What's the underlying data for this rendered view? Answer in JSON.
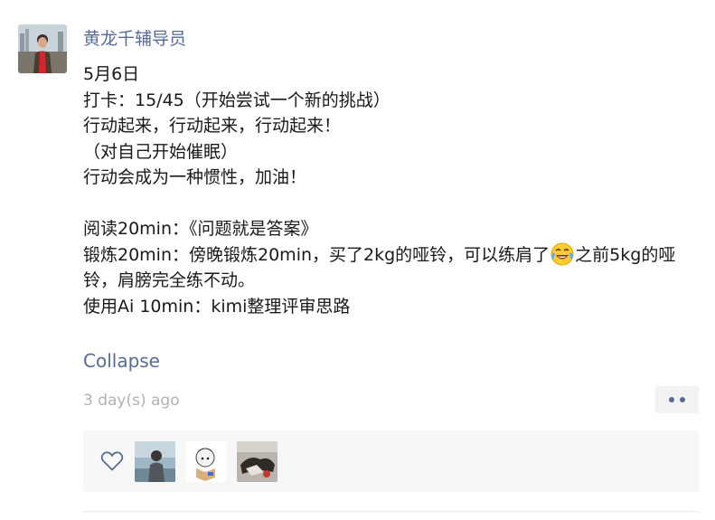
{
  "post": {
    "author": "黄龙千辅导员",
    "content_lines": [
      "5月6日",
      "打卡：15/45（开始尝试一个新的挑战）",
      "行动起来，行动起来，行动起来！",
      "（对自己开始催眠）",
      "行动会成为一种惯性，加油！",
      "",
      "阅读20min：《问题就是答案》"
    ],
    "exercise_before_emoji": "锻炼20min：傍晚锻炼20min，买了2kg的哑铃，可以练肩了",
    "exercise_after_emoji": "之前5kg的哑铃，肩膀完全练不动。",
    "emoji_name": "tears-of-joy-emoji",
    "ai_line": "使用Ai 10min：kimi整理评审思路",
    "collapse_label": "Collapse",
    "timestamp": "3 day(s) ago",
    "more_icon": "more-dots-icon",
    "like_icon": "heart-outline-icon",
    "likers": [
      "liker-avatar-1",
      "liker-avatar-2",
      "liker-avatar-3"
    ]
  },
  "colors": {
    "link": "#576b95",
    "text": "#191919",
    "meta": "#b2b2b2",
    "likes_bg": "#f7f7f7",
    "more_bg": "#f2f2f2"
  }
}
